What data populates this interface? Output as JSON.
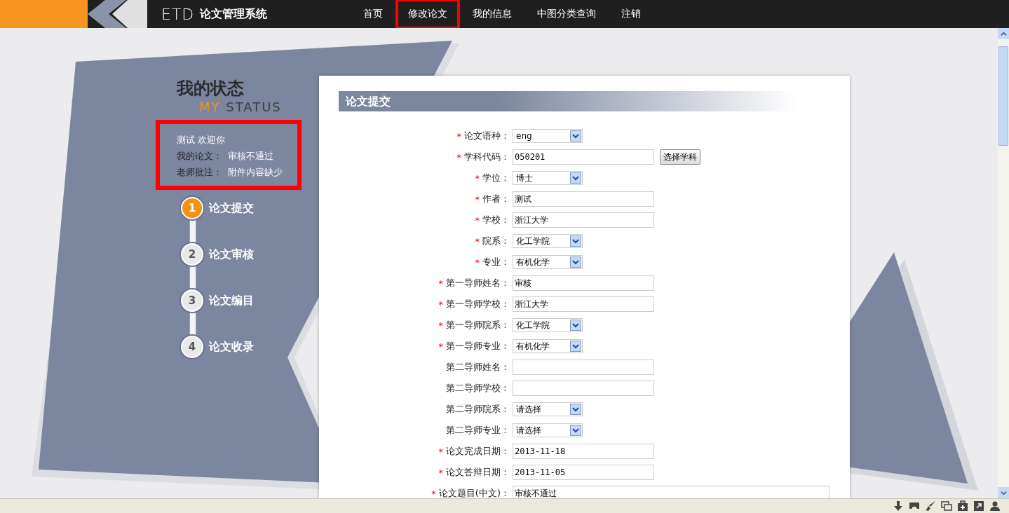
{
  "header": {
    "logo_mark": "ETD",
    "logo_text": "论文管理系统"
  },
  "nav": [
    {
      "label": "首页",
      "highlighted": false
    },
    {
      "label": "修改论文",
      "highlighted": true
    },
    {
      "label": "我的信息",
      "highlighted": false
    },
    {
      "label": "中图分类查询",
      "highlighted": false
    },
    {
      "label": "注销",
      "highlighted": false
    }
  ],
  "sidebar": {
    "title": "我的状态",
    "subtitle_accent": "MY",
    "subtitle": "STATUS",
    "status_panel": {
      "highlighted": true,
      "welcome": "测试  欢迎你",
      "lines": [
        {
          "label": "我的论文：",
          "value": "审核不通过"
        },
        {
          "label": "老师批注：",
          "value": "附件内容缺少"
        }
      ]
    },
    "steps": [
      {
        "number": "1",
        "label": "论文提交",
        "current": true
      },
      {
        "number": "2",
        "label": "论文审核",
        "current": false
      },
      {
        "number": "3",
        "label": "论文编目",
        "current": false
      },
      {
        "number": "4",
        "label": "论文收录",
        "current": false
      }
    ]
  },
  "form": {
    "title": "论文提交",
    "fields": [
      {
        "label": "论文语种：",
        "required": true,
        "kind": "select",
        "value": "eng"
      },
      {
        "label": "学科代码：",
        "required": true,
        "kind": "text",
        "value": "050201",
        "button": "选择学科"
      },
      {
        "label": "学位：",
        "required": true,
        "kind": "select",
        "value": "博士"
      },
      {
        "label": "作者：",
        "required": true,
        "kind": "text",
        "value": "测试"
      },
      {
        "label": "学校：",
        "required": true,
        "kind": "text",
        "value": "浙江大学"
      },
      {
        "label": "院系：",
        "required": true,
        "kind": "select",
        "value": "化工学院"
      },
      {
        "label": "专业：",
        "required": true,
        "kind": "select",
        "value": "有机化学"
      },
      {
        "label": "第一导师姓名：",
        "required": true,
        "kind": "text",
        "value": "审核"
      },
      {
        "label": "第一导师学校：",
        "required": true,
        "kind": "text",
        "value": "浙江大学"
      },
      {
        "label": "第一导师院系：",
        "required": true,
        "kind": "select",
        "value": "化工学院"
      },
      {
        "label": "第一导师专业：",
        "required": true,
        "kind": "select",
        "value": "有机化学"
      },
      {
        "label": "第二导师姓名：",
        "required": false,
        "kind": "text"
      },
      {
        "label": "第二导师学校：",
        "required": false,
        "kind": "text"
      },
      {
        "label": "第二导师院系：",
        "required": false,
        "kind": "select",
        "value": "请选择"
      },
      {
        "label": "第二导师专业：",
        "required": false,
        "kind": "select",
        "value": "请选择"
      },
      {
        "label": "论文完成日期：",
        "required": true,
        "kind": "text",
        "value": "2013-11-18"
      },
      {
        "label": "论文答辩日期：",
        "required": true,
        "kind": "text",
        "value": "2013-11-05"
      },
      {
        "label": "论文题目(中文)：",
        "required": true,
        "kind": "wide",
        "value": "审核不通过"
      }
    ],
    "required_mark": "*"
  }
}
